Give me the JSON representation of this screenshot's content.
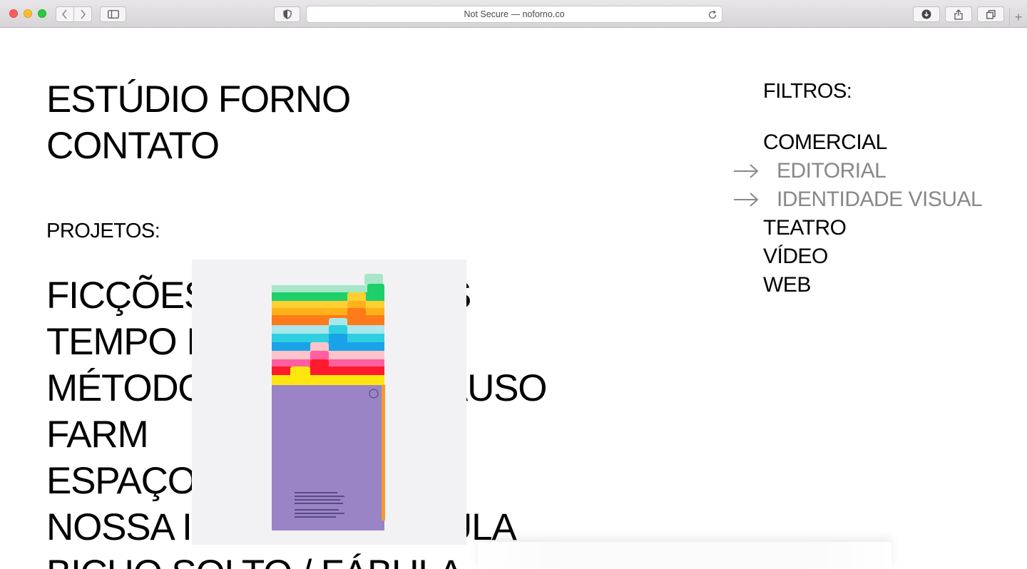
{
  "browser": {
    "url_text": "Not Secure — noforno.co",
    "new_tab": "+"
  },
  "nav": {
    "studio": "ESTÚDIO FORNO",
    "contact": "CONTATO"
  },
  "projects": {
    "label": "PROJETOS:",
    "items": [
      "FICÇÕES",
      "S",
      "TEMPO I",
      "MÉTODO GALPÃO APLAUSO",
      "FARM",
      "ESPAÇO",
      "NOSSA I",
      "ULA",
      "BICHO SOLTO / FÁBULA"
    ]
  },
  "filters": {
    "label": "FILTROS:",
    "items": [
      {
        "label": "COMERCIAL",
        "active": false
      },
      {
        "label": "EDITORIAL",
        "active": true
      },
      {
        "label": "IDENTIDADE VISUAL",
        "active": true
      },
      {
        "label": "TEATRO",
        "active": false
      },
      {
        "label": "VÍDEO",
        "active": false
      },
      {
        "label": "WEB",
        "active": false
      }
    ]
  },
  "colors": {
    "text": "#000000",
    "active_filter": "#888888",
    "background": "#ffffff",
    "booklet_cover": "#9b84c6"
  },
  "icons": [
    "back-icon",
    "forward-icon",
    "sidebar-icon",
    "shield-icon",
    "reload-icon",
    "download-icon",
    "share-icon",
    "tabs-icon",
    "arrow-right-icon"
  ]
}
